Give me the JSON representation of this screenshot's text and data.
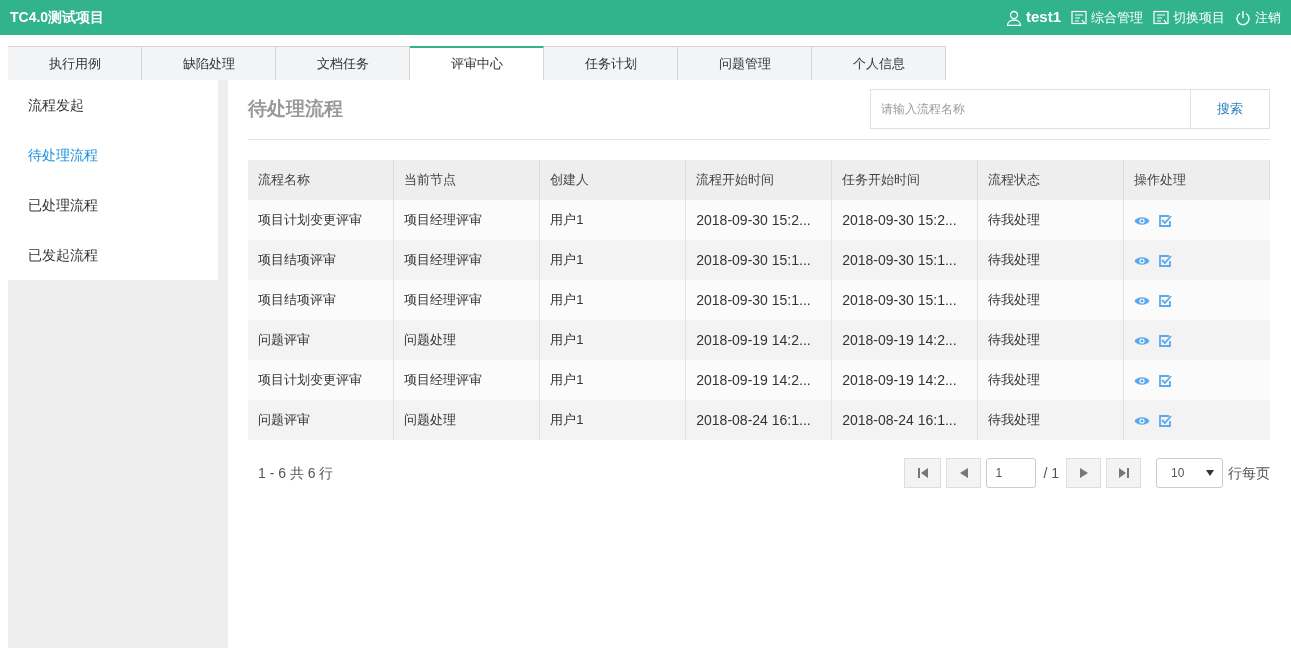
{
  "header": {
    "title": "TC4.0测试项目",
    "user": "test1",
    "links": [
      {
        "kind": "manage",
        "label": "综合管理"
      },
      {
        "kind": "switch",
        "label": "切换项目"
      },
      {
        "kind": "logout",
        "label": "注销"
      }
    ]
  },
  "tabs": [
    {
      "label": "执行用例",
      "selected": false
    },
    {
      "label": "缺陷处理",
      "selected": false
    },
    {
      "label": "文档任务",
      "selected": false
    },
    {
      "label": "评审中心",
      "selected": true
    },
    {
      "label": "任务计划",
      "selected": false
    },
    {
      "label": "问题管理",
      "selected": false
    },
    {
      "label": "个人信息",
      "selected": false
    }
  ],
  "sidebar": {
    "items": [
      {
        "label": "流程发起",
        "selected": false
      },
      {
        "label": "待处理流程",
        "selected": true
      },
      {
        "label": "已处理流程",
        "selected": false
      },
      {
        "label": "已发起流程",
        "selected": false
      }
    ]
  },
  "page_title": "待处理流程",
  "search": {
    "placeholder": "请输入流程名称",
    "button": "搜索"
  },
  "table": {
    "columns": [
      "流程名称",
      "当前节点",
      "创建人",
      "流程开始时间",
      "任务开始时间",
      "流程状态",
      "操作处理"
    ],
    "rows": [
      [
        "项目计划变更评审",
        "项目经理评审",
        "用户1",
        "2018-09-30 15:2...",
        "2018-09-30 15:2...",
        "待我处理"
      ],
      [
        "项目结项评审",
        "项目经理评审",
        "用户1",
        "2018-09-30 15:1...",
        "2018-09-30 15:1...",
        "待我处理"
      ],
      [
        "项目结项评审",
        "项目经理评审",
        "用户1",
        "2018-09-30 15:1...",
        "2018-09-30 15:1...",
        "待我处理"
      ],
      [
        "问题评审",
        "问题处理",
        "用户1",
        "2018-09-19 14:2...",
        "2018-09-19 14:2...",
        "待我处理"
      ],
      [
        "项目计划变更评审",
        "项目经理评审",
        "用户1",
        "2018-09-19 14:2...",
        "2018-09-19 14:2...",
        "待我处理"
      ],
      [
        "问题评审",
        "问题处理",
        "用户1",
        "2018-08-24 16:1...",
        "2018-08-24 16:1...",
        "待我处理"
      ]
    ]
  },
  "pager": {
    "summary": "1 - 6 共 6 行",
    "page": "1",
    "total": "/ 1",
    "page_size": "10",
    "per_page_label": "行每页"
  }
}
